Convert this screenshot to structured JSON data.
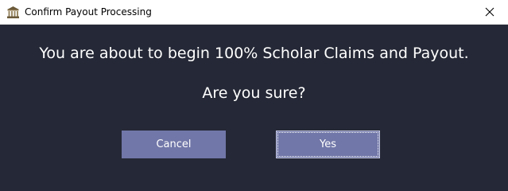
{
  "window": {
    "title": "Confirm Payout Processing",
    "app_icon": "building-icon",
    "close_icon": "close-icon"
  },
  "dialog": {
    "message": "You are about to begin 100% Scholar Claims and Payout.",
    "question": "Are you sure?",
    "cancel_label": "Cancel",
    "yes_label": "Yes"
  },
  "colors": {
    "background": "#252836",
    "button": "#7177a8",
    "text": "#ffffff"
  }
}
